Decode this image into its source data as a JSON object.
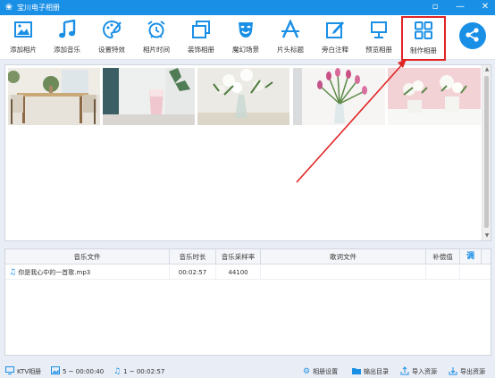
{
  "window": {
    "title": "宝川电子相册",
    "min_label": "—",
    "close_label": "✕",
    "restore_label": "▫"
  },
  "toolbar": {
    "items": [
      {
        "label": "添加相片",
        "icon": "add-photo-icon"
      },
      {
        "label": "添加音乐",
        "icon": "music-note-icon"
      },
      {
        "label": "设置特效",
        "icon": "palette-icon"
      },
      {
        "label": "相片时间",
        "icon": "alarm-clock-icon"
      },
      {
        "label": "装饰相册",
        "icon": "decorate-frame-icon"
      },
      {
        "label": "魔幻场景",
        "icon": "theater-mask-icon"
      },
      {
        "label": "片头标题",
        "icon": "title-a-icon"
      },
      {
        "label": "旁白注释",
        "icon": "edit-pen-icon"
      },
      {
        "label": "预览相册",
        "icon": "monitor-icon"
      },
      {
        "label": "制作相册",
        "icon": "grid-squares-icon"
      }
    ],
    "highlighted": "制作相册",
    "share_icon": "share-icon"
  },
  "photos": [
    {
      "name": "photo-table-chairs",
      "desc_icon": "photo-thumbnail"
    },
    {
      "name": "photo-pink-glass",
      "desc_icon": "photo-thumbnail"
    },
    {
      "name": "photo-white-roses",
      "desc_icon": "photo-thumbnail"
    },
    {
      "name": "photo-pink-tulips",
      "desc_icon": "photo-thumbnail"
    },
    {
      "name": "photo-pink-flowers-pot",
      "desc_icon": "photo-thumbnail"
    }
  ],
  "music_table": {
    "headers": {
      "file": "音乐文件",
      "duration": "音乐时长",
      "sample_rate": "音乐采样率",
      "lyrics": "歌词文件",
      "offset": "补偿值",
      "adjust": "调"
    },
    "rows": [
      {
        "file": "你是我心中的一首歌.mp3",
        "duration": "00:02:57",
        "sample_rate": "44100",
        "lyrics": "",
        "offset": ""
      }
    ]
  },
  "statusbar": {
    "ktv": "KTV相册",
    "photos_info": "5 ~ 00:00:40",
    "music_info": "1 ~ 00:02:57",
    "album_settings": "相册设置",
    "output_dir": "输出目录",
    "import": "导入资源",
    "export": "导出资源"
  },
  "colors": {
    "accent": "#1a8fe6",
    "highlight_border": "#e02424",
    "arrow": "#e02424"
  }
}
